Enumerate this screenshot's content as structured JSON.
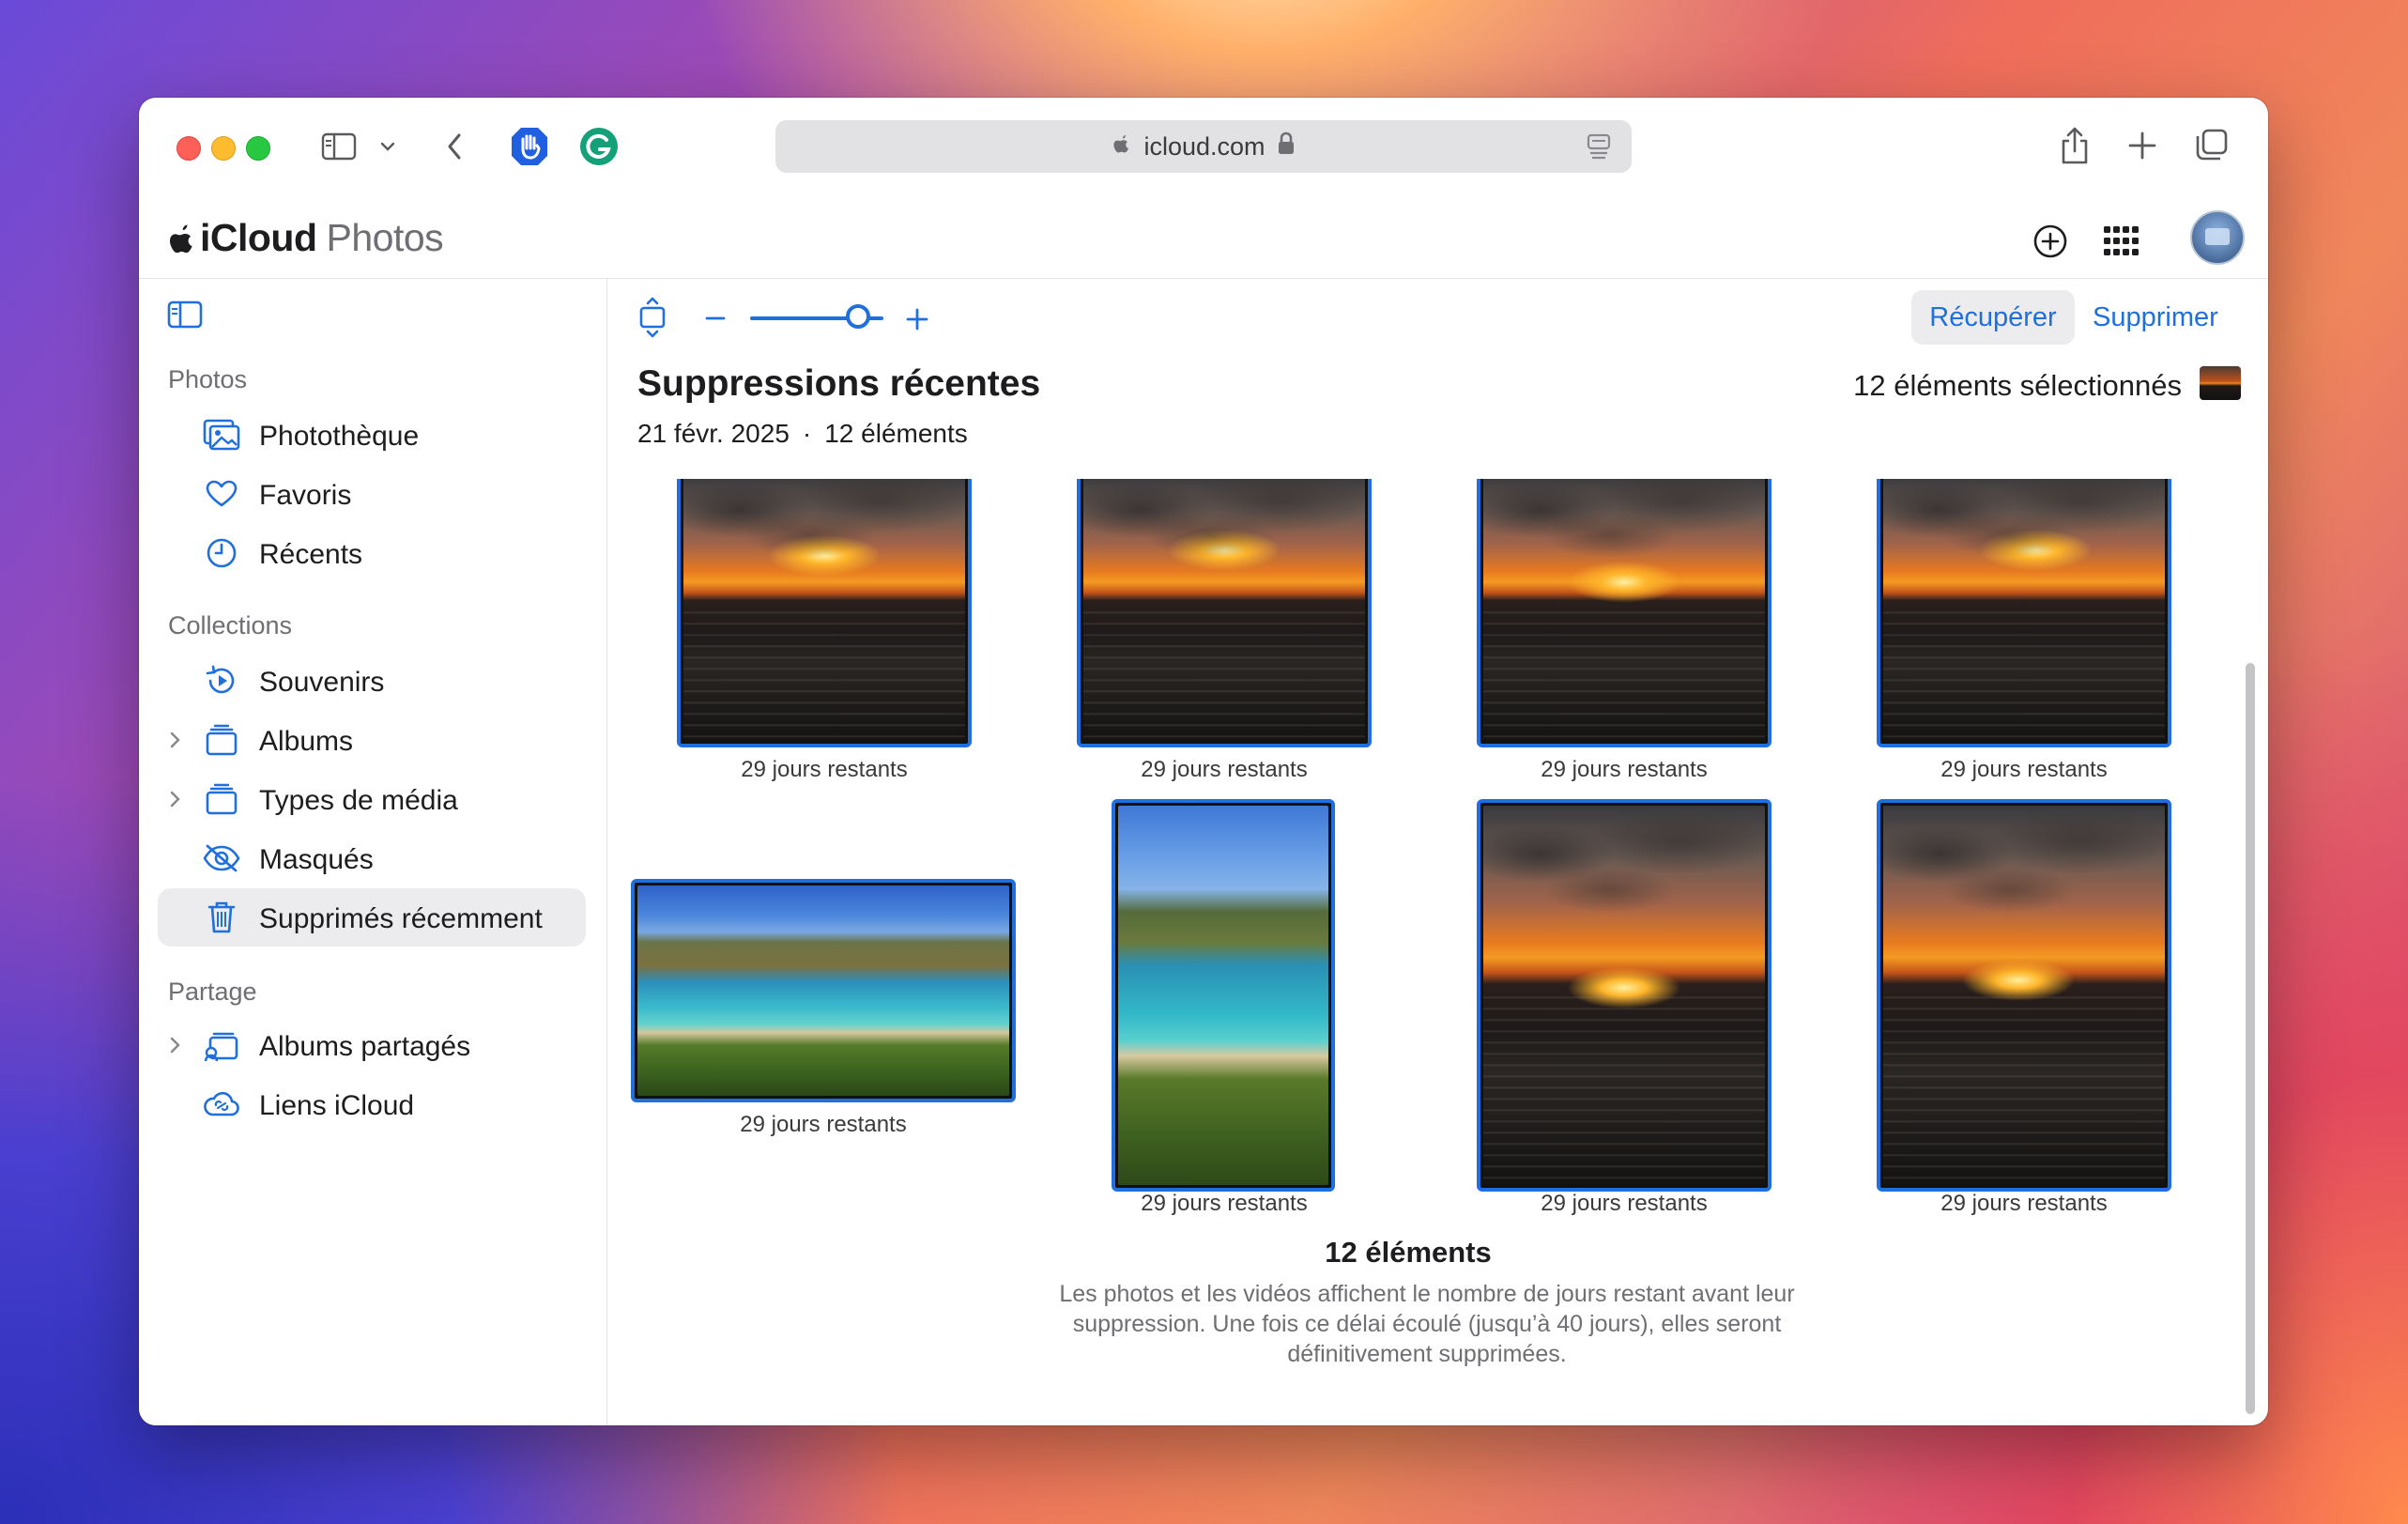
{
  "browser": {
    "url": "icloud.com"
  },
  "app": {
    "brand_main": "iCloud",
    "brand_sub": "Photos"
  },
  "sidebar": {
    "sections": [
      {
        "label": "Photos"
      },
      {
        "label": "Collections"
      },
      {
        "label": "Partage"
      }
    ],
    "items": [
      {
        "label": "Photothèque",
        "icon": "photo-library-icon"
      },
      {
        "label": "Favoris",
        "icon": "heart-icon"
      },
      {
        "label": "Récents",
        "icon": "clock-icon"
      },
      {
        "label": "Souvenirs",
        "icon": "memories-icon"
      },
      {
        "label": "Albums",
        "icon": "albums-icon"
      },
      {
        "label": "Types de média",
        "icon": "media-types-icon"
      },
      {
        "label": "Masqués",
        "icon": "hidden-eye-icon"
      },
      {
        "label": "Supprimés récemment",
        "icon": "trash-icon",
        "active": true
      },
      {
        "label": "Albums partagés",
        "icon": "shared-albums-icon"
      },
      {
        "label": "Liens iCloud",
        "icon": "icloud-link-icon"
      }
    ]
  },
  "toolbar": {
    "zoom_level": 0.75,
    "recover_label": "Récupérer",
    "delete_label": "Supprimer"
  },
  "main": {
    "title": "Suppressions récentes",
    "date": "21 févr. 2025",
    "separator": "·",
    "count": "12 éléments",
    "selected": "12 éléments sélectionnés"
  },
  "photos": [
    {
      "caption": "29 jours restants",
      "kind": "sunset"
    },
    {
      "caption": "29 jours restants",
      "kind": "sunset"
    },
    {
      "caption": "29 jours restants",
      "kind": "sunset"
    },
    {
      "caption": "29 jours restants",
      "kind": "sunset"
    },
    {
      "caption": "29 jours restants",
      "kind": "bay"
    },
    {
      "caption": "29 jours restants",
      "kind": "bay"
    },
    {
      "caption": "29 jours restants",
      "kind": "sunset"
    },
    {
      "caption": "29 jours restants",
      "kind": "sunset"
    }
  ],
  "footer": {
    "title": "12 éléments",
    "text": "Les photos et les vidéos affichent le nombre de jours restant avant leur suppression. Une fois ce délai écoulé (jusqu’à 40 jours), elles seront définitivement supprimées."
  },
  "colors": {
    "accent": "#1f6fde",
    "selection_border": "#1f6fde",
    "traffic_close": "#fe5f57",
    "traffic_minimize": "#febc2e",
    "traffic_maximize": "#28c840"
  }
}
